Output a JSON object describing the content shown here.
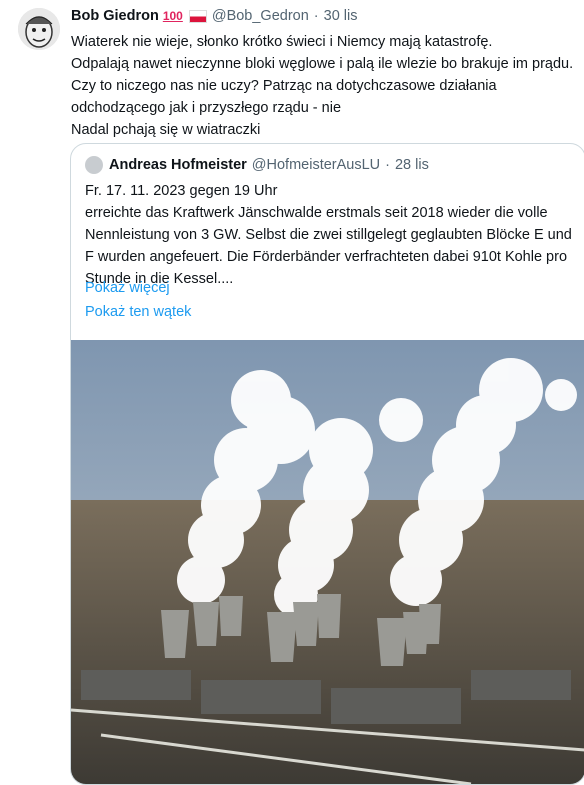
{
  "tweet": {
    "author_name": "Bob Giedron",
    "emoji_100": "100",
    "handle": "@Bob_Gedron",
    "separator": "·",
    "time": "30 lis",
    "text": "Wiaterek nie wieje, słonko krótko świeci i Niemcy mają katastrofę.\nOdpalają nawet nieczynne bloki węglowe i palą ile wlezie bo brakuje im prądu. Czy to niczego nas nie uczy? Patrząc na dotychczasowe działania odchodzącego jak i przyszłego rządu - nie\nNadal pchają się w wiatraczki"
  },
  "quoted_tweet": {
    "author_name": "Andreas Hofmeister",
    "handle": "@HofmeisterAusLU",
    "separator": "·",
    "time": "28 lis",
    "text": "Fr. 17. 11. 2023 gegen 19 Uhr\nerreichte das Kraftwerk Jänschwalde erstmals seit 2018 wieder die volle Nennleistung von 3 GW. Selbst die zwei stillgelegt geglaubten Blöcke E und F wurden angefeuert. Die Förderbänder verfrachteten dabei 910t Kohle pro Stunde in die Kessel....",
    "show_more": "Pokaż więcej",
    "show_thread": "Pokaż ten wątek"
  },
  "colors": {
    "link": "#1d9bf0",
    "secondary_text": "#536471",
    "border": "#cfd9de"
  },
  "icons": {
    "avatar": "cartoon-face-avatar",
    "flag": "poland-flag-icon"
  }
}
